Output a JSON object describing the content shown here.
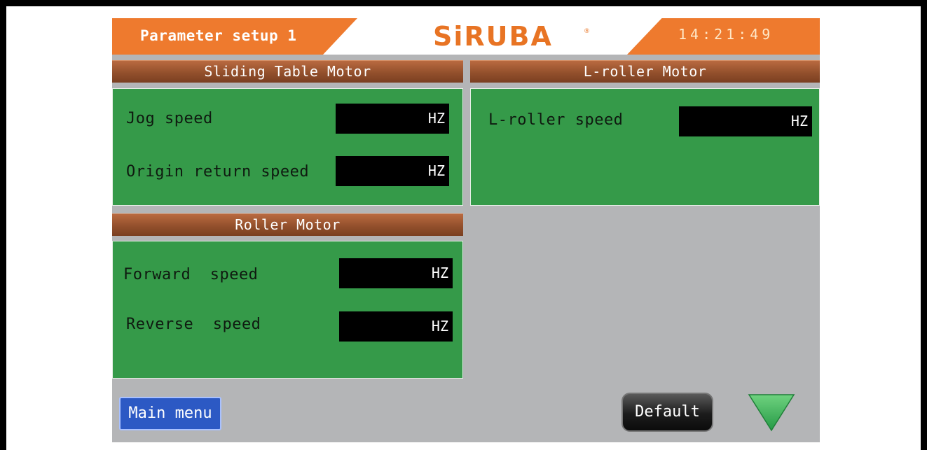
{
  "header": {
    "title": "Parameter setup 1",
    "logo": "SiRUBA",
    "logo_mark": "®",
    "clock": "14:21:49"
  },
  "sliding_table": {
    "title": "Sliding Table Motor",
    "jog_label": "Jog speed",
    "jog_unit": "HZ",
    "origin_label": "Origin return speed",
    "origin_unit": "HZ"
  },
  "roller": {
    "title": "Roller Motor",
    "forward_label": "Forward  speed",
    "forward_unit": "HZ",
    "reverse_label": "Reverse  speed",
    "reverse_unit": "HZ"
  },
  "l_roller": {
    "title": "L-roller Motor",
    "speed_label": "L-roller speed",
    "speed_unit": "HZ"
  },
  "footer": {
    "main_menu": "Main menu",
    "default": "Default",
    "next_icon": "triangle-down-icon"
  },
  "colors": {
    "header_orange": "#ee7a2e",
    "panel_green": "#359a49",
    "bar_brown": "#93502c",
    "screen_gray": "#b4b5b7",
    "button_blue": "#2c59c4",
    "arrow_green": "#3fb35a"
  }
}
